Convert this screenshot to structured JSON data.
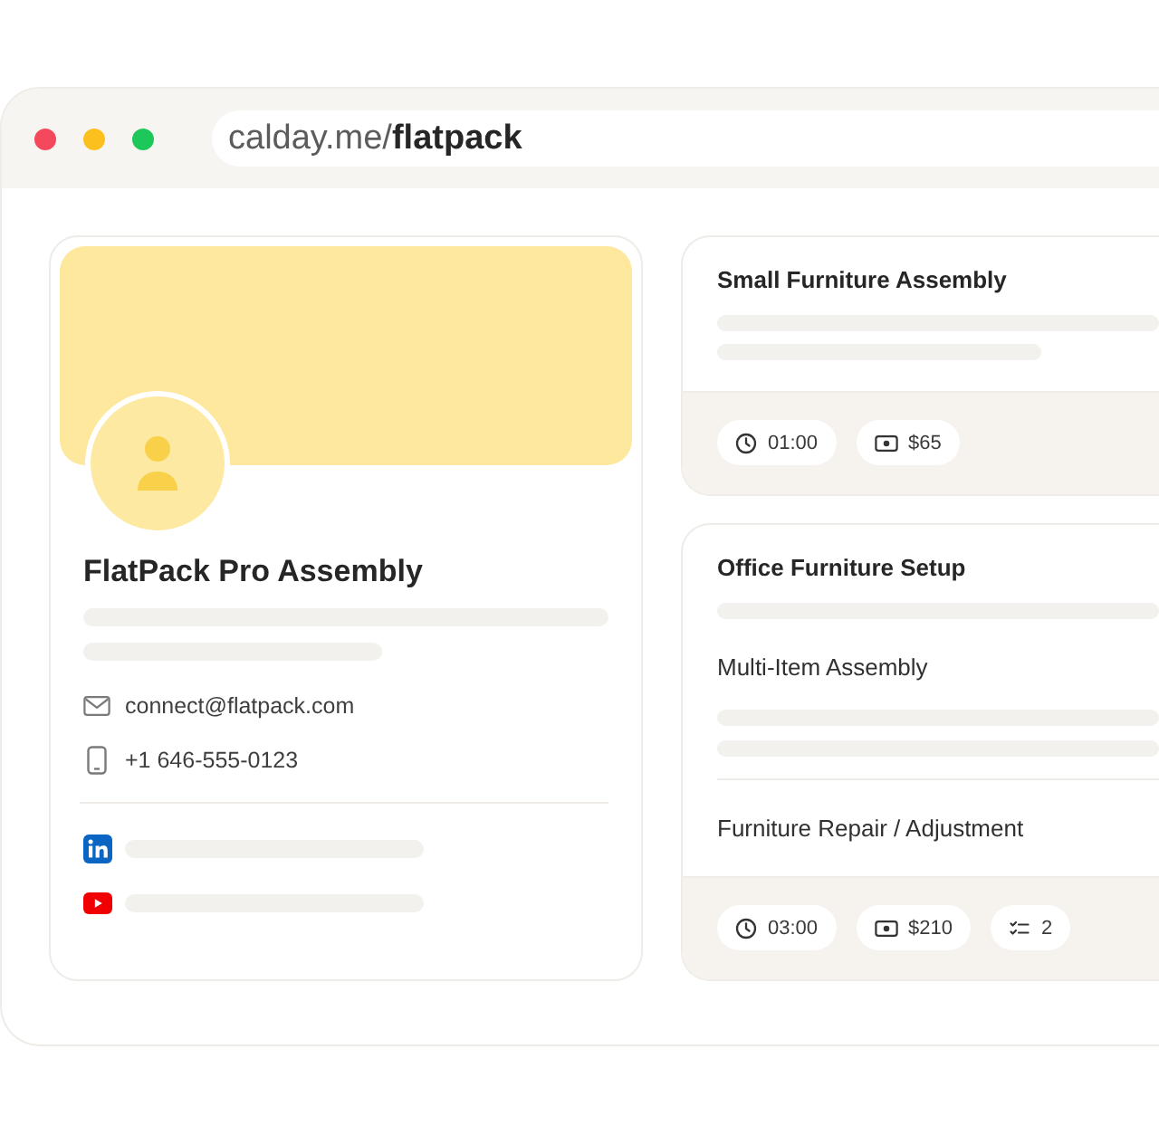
{
  "browser": {
    "url": "calday.me/**flatpack**"
  },
  "profile": {
    "name": "FlatPack Pro Assembly",
    "contacts": [
      {
        "kind": "email",
        "text": "connect@flatpack.com"
      },
      {
        "kind": "phone",
        "text": "+1 646-555-0123"
      }
    ],
    "socials": [
      {
        "kind": "linkedin"
      },
      {
        "kind": "youtube"
      }
    ]
  },
  "services": [
    {
      "title": "Small Furniture Assembly",
      "chips": [
        {
          "kind": "duration",
          "text": "01:00"
        },
        {
          "kind": "price",
          "text": "$65"
        }
      ]
    },
    {
      "title": "Office Furniture Setup",
      "items": [
        "Multi-Item Assembly",
        "Furniture Repair / Adjustment"
      ],
      "chips": [
        {
          "kind": "duration",
          "text": "03:00"
        },
        {
          "kind": "price",
          "text": "$210"
        },
        {
          "kind": "count",
          "text": "2"
        }
      ]
    }
  ]
}
